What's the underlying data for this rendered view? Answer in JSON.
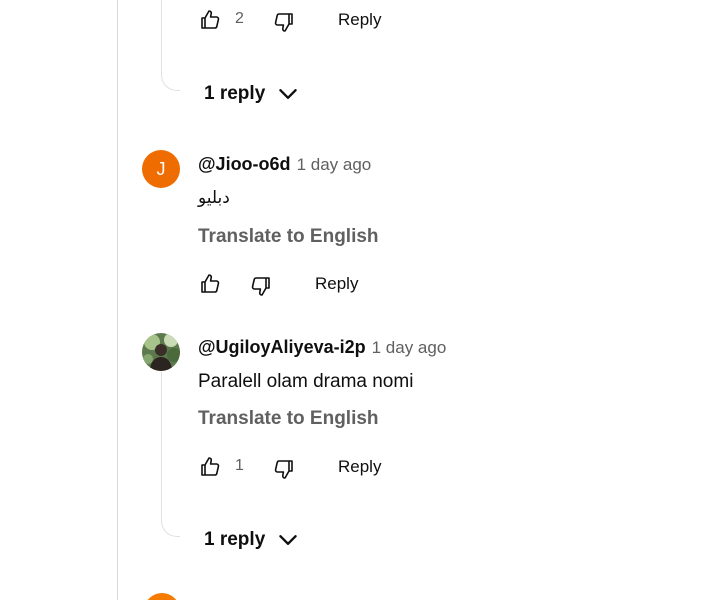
{
  "previous_comment": {
    "like_count": "2",
    "reply_label": "Reply",
    "replies_toggle": "1 reply"
  },
  "comments": [
    {
      "avatar_letter": "J",
      "handle": "@Jioo-o6d",
      "time": "1 day ago",
      "text": "دبليو",
      "translate_label": "Translate to English",
      "like_count": "",
      "reply_label": "Reply"
    },
    {
      "handle": "@UgiloyAliyeva-i2p",
      "time": "1 day ago",
      "text": "Paralell olam drama nomi",
      "translate_label": "Translate to English",
      "like_count": "1",
      "reply_label": "Reply",
      "replies_toggle": "1 reply"
    }
  ],
  "colors": {
    "avatar_orange": "#ef6c00",
    "secondary_text": "#606060",
    "primary_text": "#0f0f0f"
  },
  "icons": [
    "thumbs-up-icon",
    "thumbs-down-icon",
    "chevron-down-icon"
  ]
}
